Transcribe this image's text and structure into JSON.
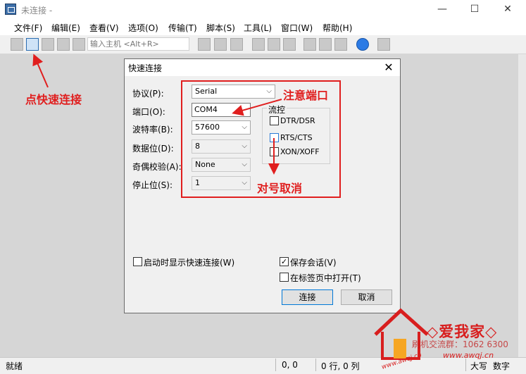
{
  "window": {
    "title": "未连接 -",
    "minimize": "—",
    "maximize": "☐",
    "close": "✕"
  },
  "menu": [
    "文件(F)",
    "编辑(E)",
    "查看(V)",
    "选项(O)",
    "传输(T)",
    "脚本(S)",
    "工具(L)",
    "窗口(W)",
    "帮助(H)"
  ],
  "toolbar": {
    "host_placeholder": "输入主机 <Alt+R>"
  },
  "dialog": {
    "title": "快速连接",
    "close": "✕",
    "protocol": {
      "label": "协议(P):",
      "value": "Serial"
    },
    "port": {
      "label": "端口(O):",
      "value": "COM4"
    },
    "baud": {
      "label": "波特率(B):",
      "value": "57600"
    },
    "databits": {
      "label": "数据位(D):",
      "value": "8"
    },
    "parity": {
      "label": "奇偶校验(A):",
      "value": "None"
    },
    "stopbits": {
      "label": "停止位(S):",
      "value": "1"
    },
    "flow": {
      "title": "流控",
      "items": [
        {
          "label": "DTR/DSR",
          "checked": false
        },
        {
          "label": "RTS/CTS",
          "checked": false
        },
        {
          "label": "XON/XOFF",
          "checked": false
        }
      ]
    },
    "startup_show": {
      "label": "启动时显示快速连接(W)",
      "checked": false
    },
    "save_session": {
      "label": "保存会话(V)",
      "checked": true
    },
    "open_in_tab": {
      "label": "在标签页中打开(T)",
      "checked": false
    },
    "connect": "连接",
    "cancel": "取消"
  },
  "annotations": {
    "click_quick": "点快速连接",
    "note_port": "注意端口",
    "uncheck": "对号取消"
  },
  "status": {
    "ready": "就绪",
    "pos": "0, 0",
    "rowcol": "0 行, 0 列",
    "ins": "大写",
    "num": "数字"
  },
  "watermark": {
    "brand": "◇爱我家◇",
    "group": "刷机交流群：1062 6300",
    "url": "www.awqj.cn",
    "url_small": "www.awqj.cn"
  }
}
